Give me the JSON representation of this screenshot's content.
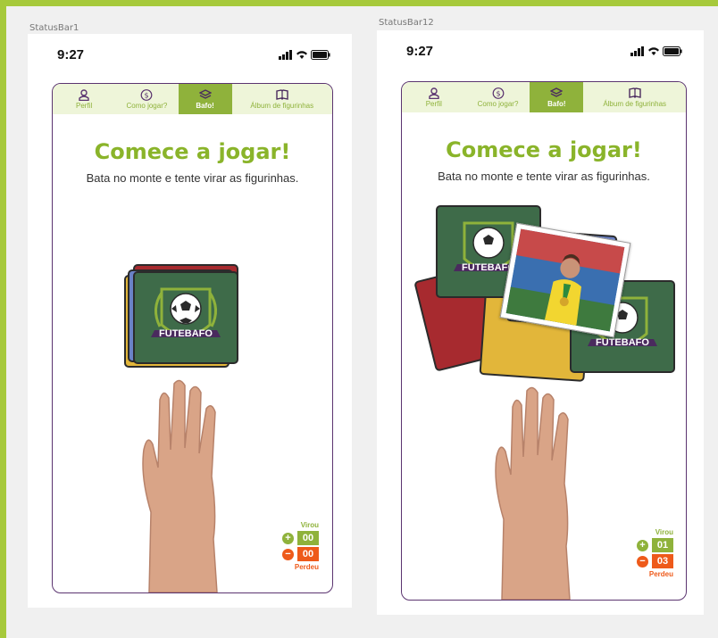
{
  "colors": {
    "accent_green": "#8fb23b",
    "title_green": "#8ab42a",
    "orange": "#ee5a1a",
    "purple_border": "#5b3470"
  },
  "screens": [
    {
      "label": "StatusBar1",
      "time": "9:27",
      "tabs": [
        "Perfil",
        "Como jogar?",
        "Bafo!",
        "Álbum de figurinhas"
      ],
      "title": "Comece a jogar!",
      "subtitle": "Bata no monte e tente virar as figurinhas.",
      "sticker_text": "FUTEBAFO",
      "virou_label": "Virou",
      "virou_value": "00",
      "perdeu_label": "Perdeu",
      "perdeu_value": "00",
      "plus": "+",
      "minus": "−"
    },
    {
      "label": "StatusBar12",
      "time": "9:27",
      "tabs": [
        "Perfil",
        "Como jogar?",
        "Bafo!",
        "Álbum de figurinhas"
      ],
      "title": "Comece a jogar!",
      "subtitle": "Bata no monte e tente virar as figurinhas.",
      "sticker_text": "FUTEBAFO",
      "virou_label": "Virou",
      "virou_value": "01",
      "perdeu_label": "Perdeu",
      "perdeu_value": "03",
      "plus": "+",
      "minus": "−"
    }
  ],
  "icons": [
    "profile-icon",
    "help-icon",
    "layers-icon",
    "book-icon",
    "signal-icon",
    "wifi-icon",
    "battery-icon",
    "soccer-ball-icon"
  ]
}
